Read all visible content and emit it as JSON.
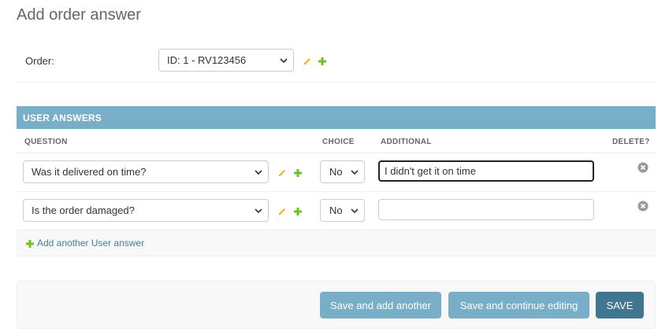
{
  "page": {
    "title": "Add order answer"
  },
  "order": {
    "label": "Order:",
    "selected": "ID: 1 - RV123456"
  },
  "inline": {
    "title": "USER ANSWERS",
    "columns": {
      "question": "QUESTION",
      "choice": "CHOICE",
      "additional": "ADDITIONAL",
      "delete": "DELETE?"
    },
    "rows": [
      {
        "question": "Was it delivered on time?",
        "choice": "No",
        "additional": "I didn't get it on time"
      },
      {
        "question": "Is the order damaged?",
        "choice": "No",
        "additional": ""
      }
    ],
    "add_another": "Add another User answer"
  },
  "buttons": {
    "save_add": "Save and add another",
    "save_continue": "Save and continue editing",
    "save": "SAVE"
  },
  "colors": {
    "header": "#79aec8",
    "primary": "#417690",
    "icon_green": "#70bf2b",
    "icon_yellow": "#efb80b"
  }
}
